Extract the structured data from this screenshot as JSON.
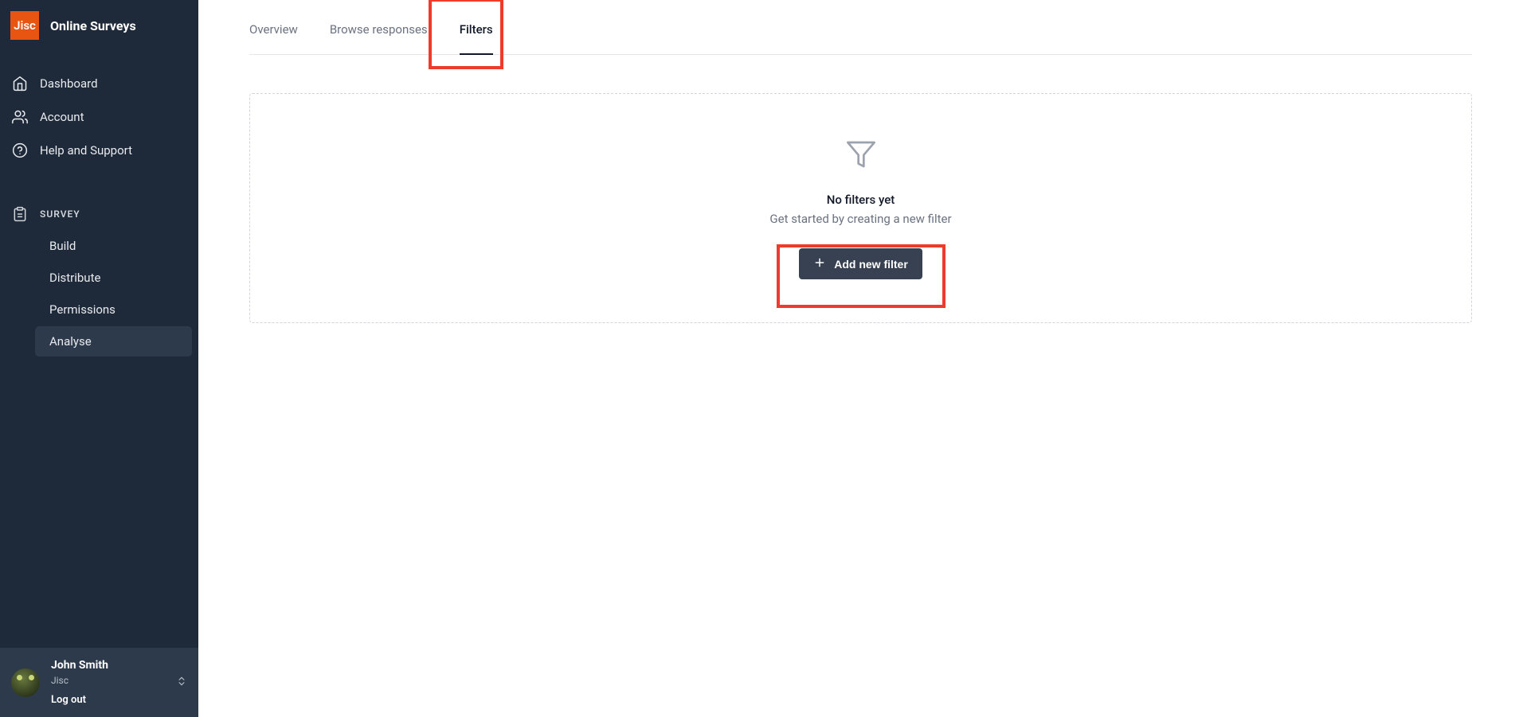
{
  "app": {
    "logo_text": "Jisc",
    "title": "Online Surveys"
  },
  "nav": {
    "dashboard": "Dashboard",
    "account": "Account",
    "help": "Help and Support"
  },
  "survey_section": {
    "label": "SURVEY",
    "items": {
      "build": "Build",
      "distribute": "Distribute",
      "permissions": "Permissions",
      "analyse": "Analyse"
    }
  },
  "user": {
    "name": "John Smith",
    "org": "Jisc",
    "logout": "Log out"
  },
  "tabs": {
    "overview": "Overview",
    "browse": "Browse responses",
    "filters": "Filters"
  },
  "empty": {
    "title": "No filters yet",
    "subtitle": "Get started by creating a new filter",
    "button": "Add new filter"
  }
}
